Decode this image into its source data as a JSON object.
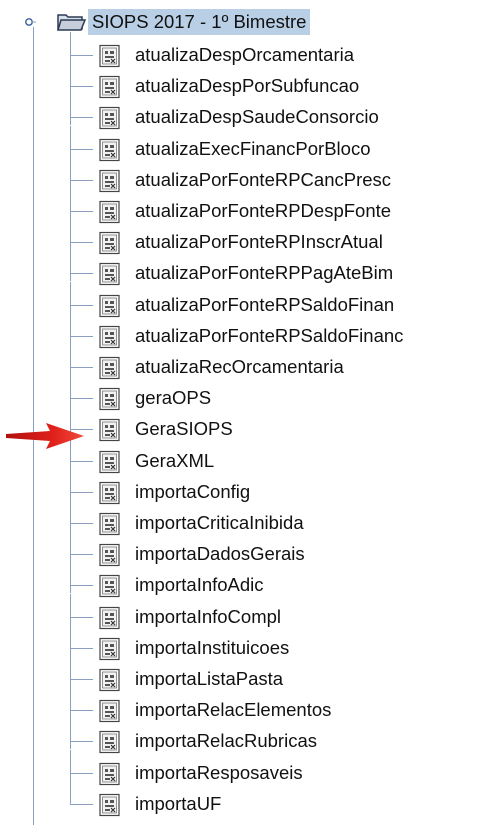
{
  "tree": {
    "root": {
      "label": "SIOPS 2017 - 1º Bimestre",
      "icon": "folder-open-icon",
      "expanded": true
    },
    "items": [
      {
        "label": "atualizaDespOrcamentaria",
        "icon": "document-icon"
      },
      {
        "label": "atualizaDespPorSubfuncao",
        "icon": "document-icon"
      },
      {
        "label": "atualizaDespSaudeConsorcio",
        "icon": "document-icon"
      },
      {
        "label": "atualizaExecFinancPorBloco",
        "icon": "document-icon"
      },
      {
        "label": "atualizaPorFonteRPCancPresc",
        "icon": "document-icon"
      },
      {
        "label": "atualizaPorFonteRPDespFonte",
        "icon": "document-icon"
      },
      {
        "label": "atualizaPorFonteRPInscrAtual",
        "icon": "document-icon"
      },
      {
        "label": "atualizaPorFonteRPPagAteBim",
        "icon": "document-icon"
      },
      {
        "label": "atualizaPorFonteRPSaldoFinan",
        "icon": "document-icon"
      },
      {
        "label": "atualizaPorFonteRPSaldoFinanc",
        "icon": "document-icon"
      },
      {
        "label": "atualizaRecOrcamentaria",
        "icon": "document-icon"
      },
      {
        "label": "geraOPS",
        "icon": "document-icon"
      },
      {
        "label": "GeraSIOPS",
        "icon": "document-icon",
        "highlighted": true
      },
      {
        "label": "GeraXML",
        "icon": "document-icon"
      },
      {
        "label": "importaConfig",
        "icon": "document-icon"
      },
      {
        "label": "importaCriticaInibida",
        "icon": "document-icon"
      },
      {
        "label": "importaDadosGerais",
        "icon": "document-icon"
      },
      {
        "label": "importaInfoAdic",
        "icon": "document-icon"
      },
      {
        "label": "importaInfoCompl",
        "icon": "document-icon"
      },
      {
        "label": "importaInstituicoes",
        "icon": "document-icon"
      },
      {
        "label": "importaListaPasta",
        "icon": "document-icon"
      },
      {
        "label": "importaRelacElementos",
        "icon": "document-icon"
      },
      {
        "label": "importaRelacRubricas",
        "icon": "document-icon"
      },
      {
        "label": "importaResposaveis",
        "icon": "document-icon"
      },
      {
        "label": "importaUF",
        "icon": "document-icon"
      }
    ]
  },
  "annotation": {
    "icon": "red-arrow-icon",
    "color": "#e0201b"
  },
  "colors": {
    "selection": "#b8cfe5",
    "tree_line": "#8a9fc2"
  }
}
